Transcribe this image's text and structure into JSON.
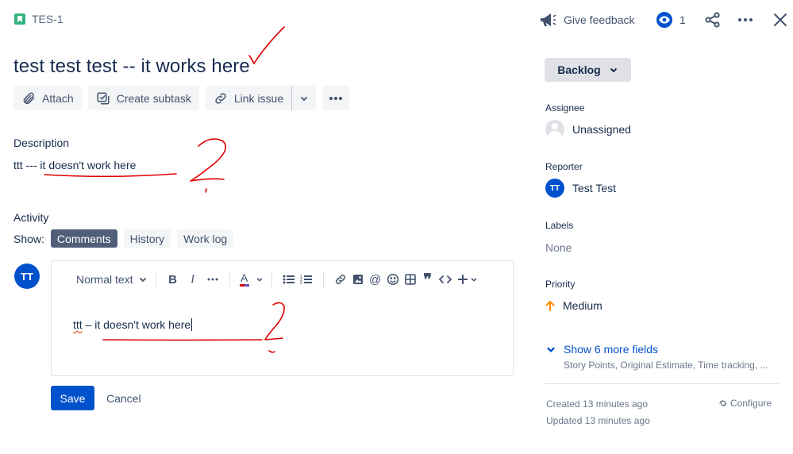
{
  "issue": {
    "key": "TES-1",
    "summary": "test test test -- it works here"
  },
  "toolbar": {
    "attach": "Attach",
    "create_subtask": "Create subtask",
    "link_issue": "Link issue"
  },
  "description": {
    "label": "Description",
    "text": "ttt --- it doesn't work here"
  },
  "activity": {
    "label": "Activity",
    "show_label": "Show:",
    "tabs": [
      "Comments",
      "History",
      "Work log"
    ],
    "active_tab": "Comments"
  },
  "comment": {
    "avatar_initials": "TT",
    "text_format": "Normal text",
    "text_word_misspelled": "ttt",
    "text_rest": " – it doesn't work here",
    "save": "Save",
    "cancel": "Cancel"
  },
  "header_actions": {
    "feedback": "Give feedback",
    "watch_count": "1"
  },
  "panel": {
    "status": "Backlog",
    "assignee_label": "Assignee",
    "assignee_value": "Unassigned",
    "reporter_label": "Reporter",
    "reporter_initials": "TT",
    "reporter_value": "Test Test",
    "labels_label": "Labels",
    "labels_value": "None",
    "priority_label": "Priority",
    "priority_value": "Medium",
    "show_more": "Show 6 more fields",
    "more_fields": "Story Points, Original Estimate, Time tracking, ...",
    "created": "Created 13 minutes ago",
    "updated": "Updated 13 minutes ago",
    "configure": "Configure"
  },
  "colors": {
    "primary": "#0052cc",
    "text": "#172b4d",
    "subtle": "#42526e",
    "priority_medium": "#ff8b00",
    "story": "#36b37e",
    "annotation": "#e00000"
  }
}
